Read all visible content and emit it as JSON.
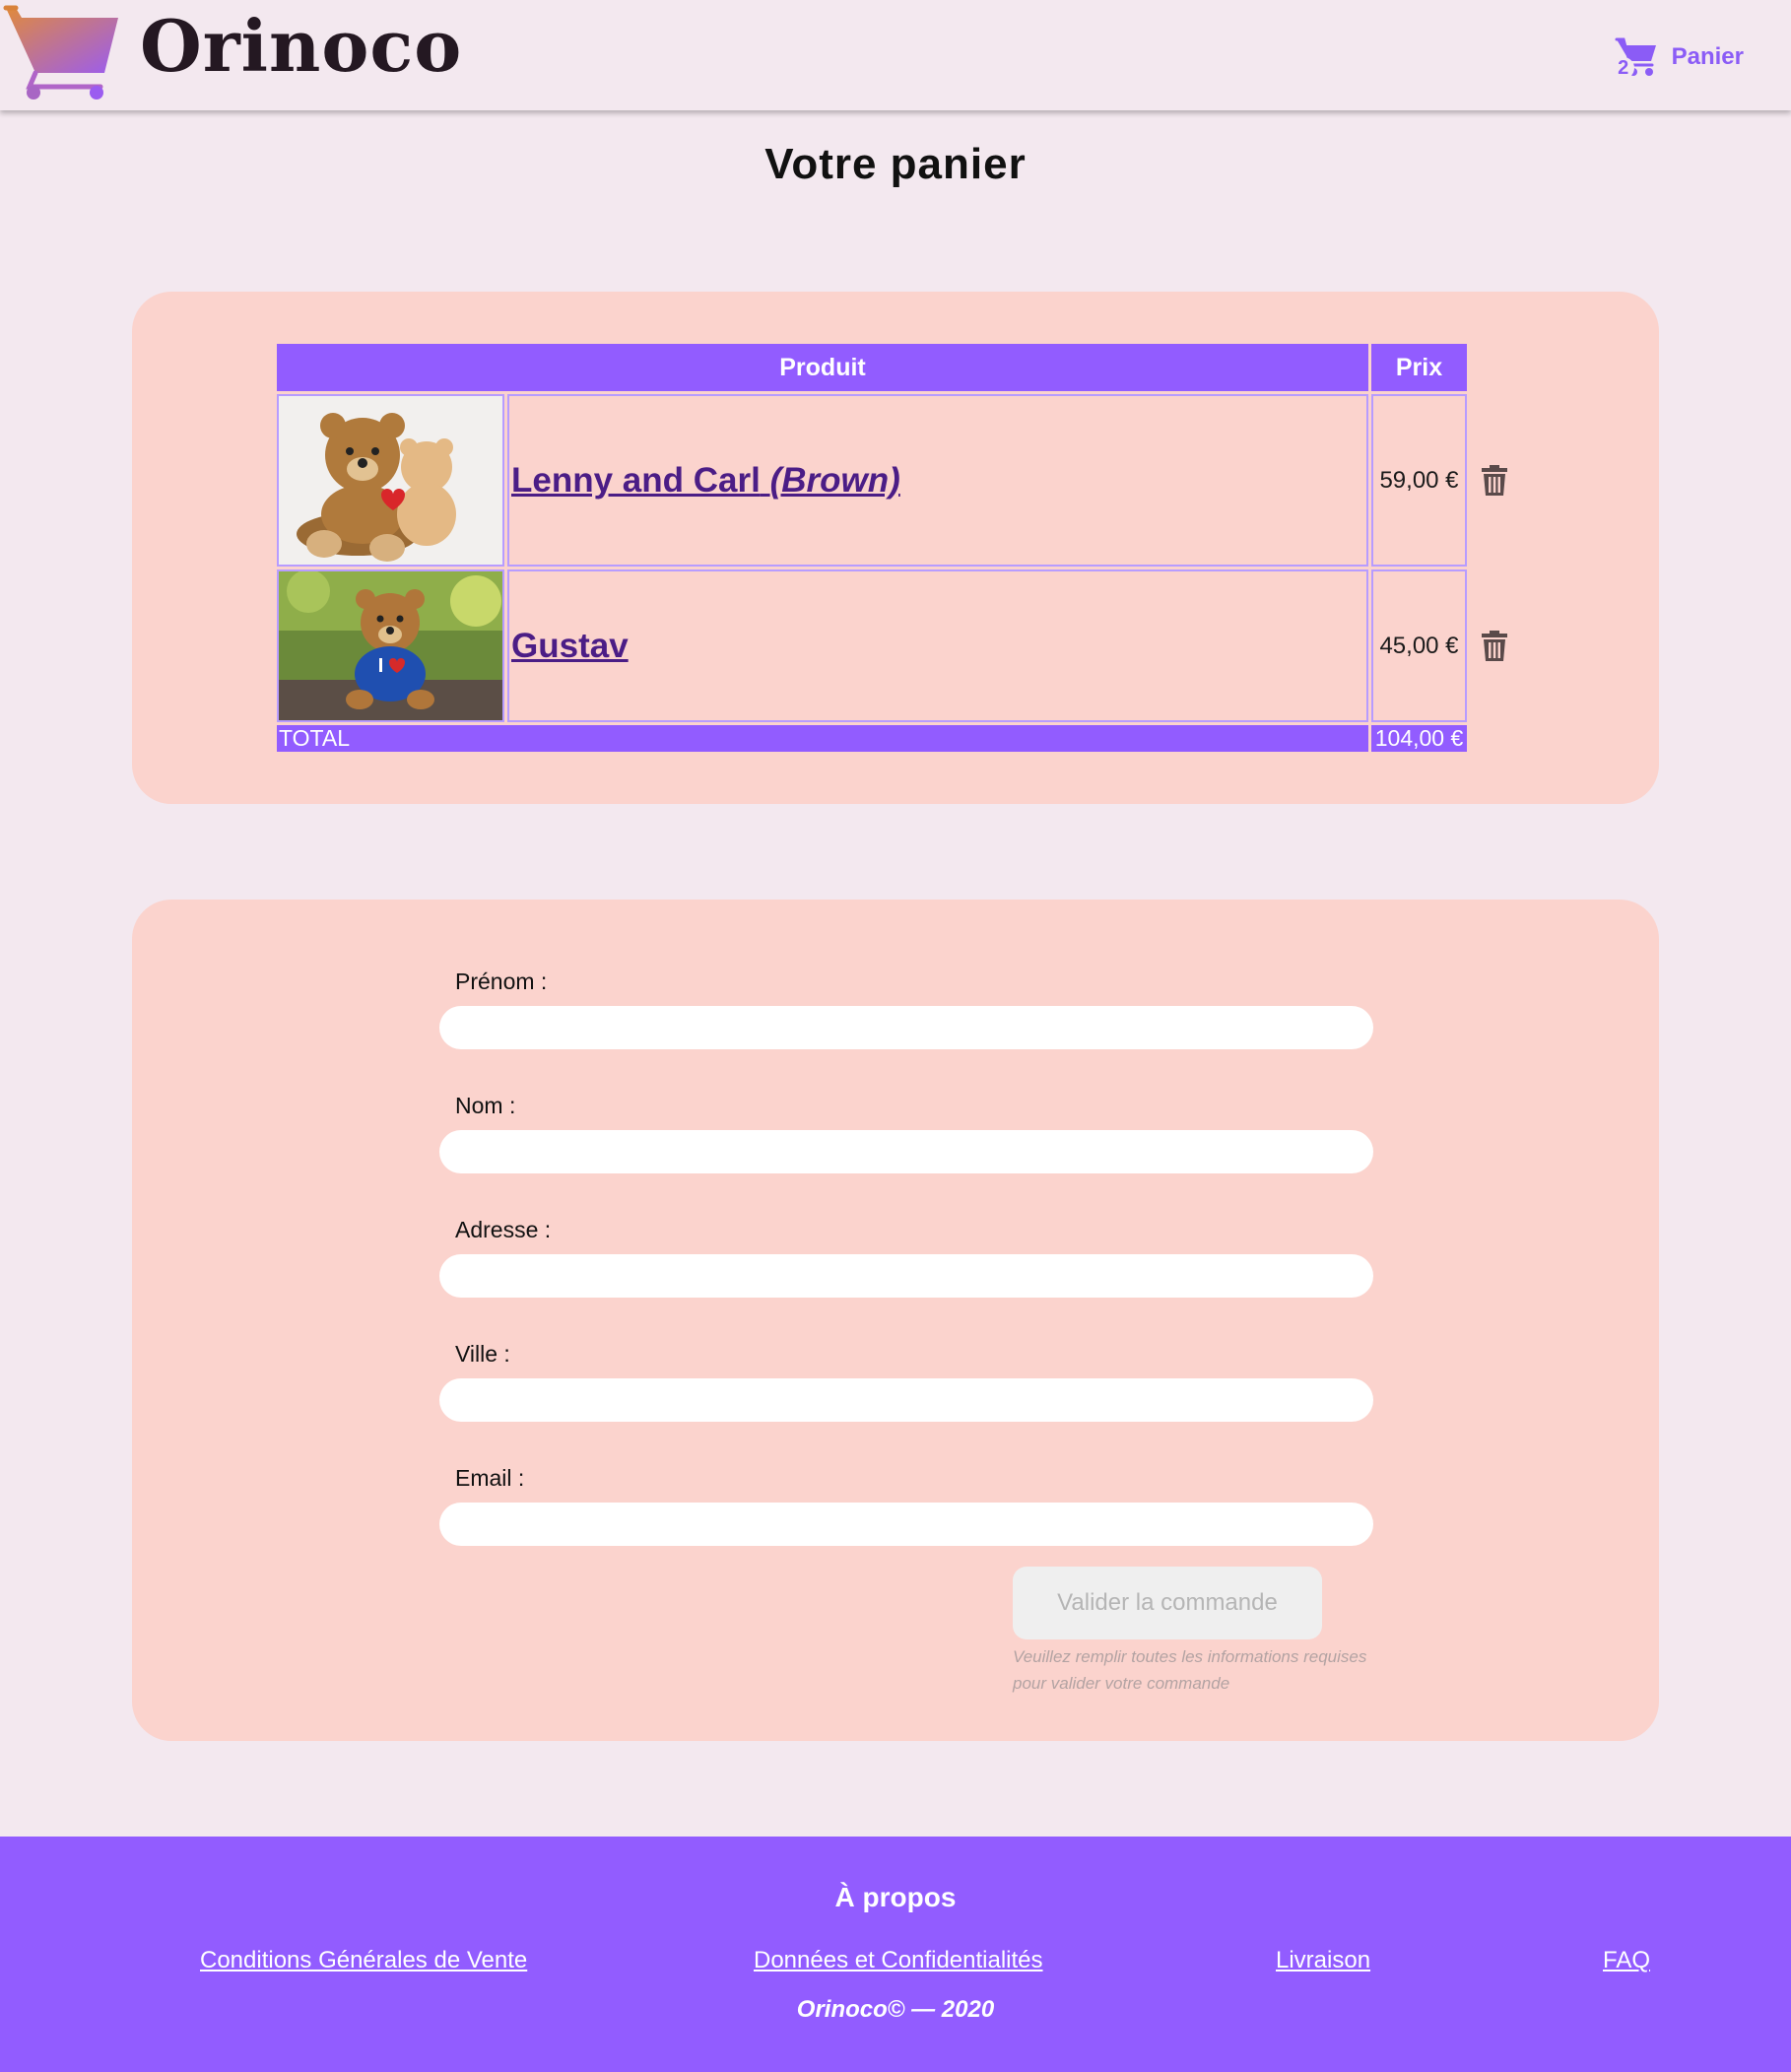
{
  "header": {
    "logo_text": "Orinoco",
    "cart_count": "2",
    "cart_label": "Panier"
  },
  "page_title": "Votre panier",
  "cart": {
    "headers": {
      "product": "Produit",
      "price": "Prix"
    },
    "items": [
      {
        "name": "Lenny and Carl",
        "variant": "(Brown)",
        "price": "59,00 €"
      },
      {
        "name": "Gustav",
        "variant": "",
        "price": "45,00 €"
      }
    ],
    "total_label": "TOTAL",
    "total_value": "104,00 €"
  },
  "form": {
    "fields": [
      {
        "label": "Prénom :",
        "value": ""
      },
      {
        "label": "Nom :",
        "value": ""
      },
      {
        "label": "Adresse :",
        "value": ""
      },
      {
        "label": "Ville :",
        "value": ""
      },
      {
        "label": "Email :",
        "value": ""
      }
    ],
    "submit_label": "Valider la commande",
    "help_text": "Veuillez remplir toutes les informations requises pour valider votre commande"
  },
  "footer": {
    "title": "À propos",
    "links": [
      "Conditions Générales de Vente",
      "Données et Confidentialités",
      "Livraison",
      "FAQ"
    ],
    "copyright": "Orinoco© — 2020"
  },
  "colors": {
    "accent": "#925cff",
    "background": "#f3e8ef",
    "card": "#fbd3cd",
    "product_link": "#4b1d86"
  },
  "icons": [
    "shopping-cart-icon",
    "trash-icon"
  ]
}
